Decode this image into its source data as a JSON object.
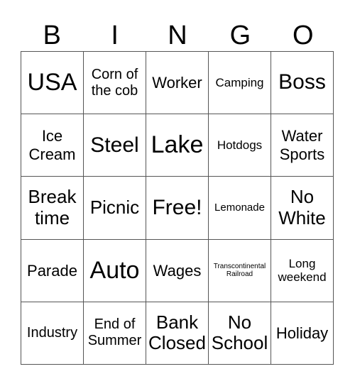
{
  "header": [
    "B",
    "I",
    "N",
    "G",
    "O"
  ],
  "cells": [
    {
      "text": "USA",
      "size": "s-xl"
    },
    {
      "text": "Corn of the cob",
      "size": "s-sm"
    },
    {
      "text": "Worker",
      "size": "s-m"
    },
    {
      "text": "Camping",
      "size": "s-s"
    },
    {
      "text": "Boss",
      "size": "s-l"
    },
    {
      "text": "Ice Cream",
      "size": "s-m"
    },
    {
      "text": "Steel",
      "size": "s-l"
    },
    {
      "text": "Lake",
      "size": "s-xl"
    },
    {
      "text": "Hotdogs",
      "size": "s-s"
    },
    {
      "text": "Water Sports",
      "size": "s-m"
    },
    {
      "text": "Break time",
      "size": "s-ml"
    },
    {
      "text": "Picnic",
      "size": "s-ml"
    },
    {
      "text": "Free!",
      "size": "s-l"
    },
    {
      "text": "Lemonade",
      "size": "s-xs"
    },
    {
      "text": "No White",
      "size": "s-ml"
    },
    {
      "text": "Parade",
      "size": "s-m"
    },
    {
      "text": "Auto",
      "size": "s-xl"
    },
    {
      "text": "Wages",
      "size": "s-m"
    },
    {
      "text": "Transcontinental Railroad",
      "size": "s-xxs"
    },
    {
      "text": "Long weekend",
      "size": "s-s"
    },
    {
      "text": "Industry",
      "size": "s-sm"
    },
    {
      "text": "End of Summer",
      "size": "s-sm"
    },
    {
      "text": "Bank Closed",
      "size": "s-ml"
    },
    {
      "text": "No School",
      "size": "s-ml"
    },
    {
      "text": "Holiday",
      "size": "s-m"
    }
  ]
}
